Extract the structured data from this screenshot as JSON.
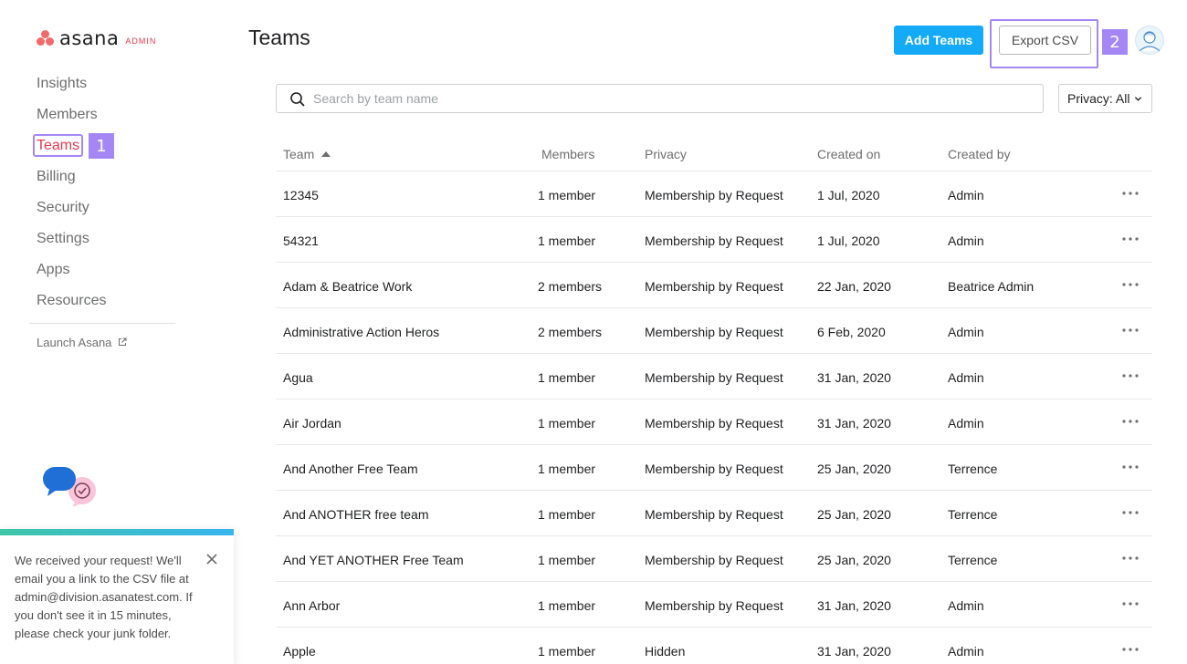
{
  "logo": {
    "word": "asana",
    "tag": "ADMIN"
  },
  "sidebar": {
    "items": [
      {
        "label": "Insights",
        "name": "sidebar-item-insights",
        "active": false
      },
      {
        "label": "Members",
        "name": "sidebar-item-members",
        "active": false
      },
      {
        "label": "Teams",
        "name": "sidebar-item-teams",
        "active": true,
        "callout": "1"
      },
      {
        "label": "Billing",
        "name": "sidebar-item-billing",
        "active": false
      },
      {
        "label": "Security",
        "name": "sidebar-item-security",
        "active": false
      },
      {
        "label": "Settings",
        "name": "sidebar-item-settings",
        "active": false
      },
      {
        "label": "Apps",
        "name": "sidebar-item-apps",
        "active": false
      },
      {
        "label": "Resources",
        "name": "sidebar-item-resources",
        "active": false
      }
    ],
    "launch_label": "Launch Asana",
    "launch_icon": "external-link-icon"
  },
  "toast": {
    "message": "We received your request! We'll email you a link to the CSV file at admin@division.asanatest.com. If you don't see it in 15 minutes, please check your junk folder."
  },
  "header": {
    "title": "Teams",
    "add_label": "Add Teams",
    "export_label": "Export CSV",
    "export_callout": "2"
  },
  "search": {
    "placeholder": "Search by team name",
    "value": ""
  },
  "filter": {
    "privacy_label": "Privacy: All"
  },
  "colors": {
    "accent": "#14aaf5",
    "active_nav": "#e8384f",
    "callout": "#a487f5",
    "brand": "#f06a6a"
  },
  "table": {
    "headers": {
      "team": "Team",
      "members": "Members",
      "privacy": "Privacy",
      "created_on": "Created on",
      "created_by": "Created by"
    },
    "rows": [
      {
        "team": "12345",
        "members": "1 member",
        "privacy": "Membership by Request",
        "created_on": "1 Jul, 2020",
        "created_by": "Admin"
      },
      {
        "team": "54321",
        "members": "1 member",
        "privacy": "Membership by Request",
        "created_on": "1 Jul, 2020",
        "created_by": "Admin"
      },
      {
        "team": "Adam & Beatrice Work",
        "members": "2 members",
        "privacy": "Membership by Request",
        "created_on": "22 Jan, 2020",
        "created_by": "Beatrice Admin"
      },
      {
        "team": "Administrative Action Heros",
        "members": "2 members",
        "privacy": "Membership by Request",
        "created_on": "6 Feb, 2020",
        "created_by": "Admin"
      },
      {
        "team": "Agua",
        "members": "1 member",
        "privacy": "Membership by Request",
        "created_on": "31 Jan, 2020",
        "created_by": "Admin"
      },
      {
        "team": "Air Jordan",
        "members": "1 member",
        "privacy": "Membership by Request",
        "created_on": "31 Jan, 2020",
        "created_by": "Admin"
      },
      {
        "team": "And Another Free Team",
        "members": "1 member",
        "privacy": "Membership by Request",
        "created_on": "25 Jan, 2020",
        "created_by": "Terrence"
      },
      {
        "team": "And ANOTHER free team",
        "members": "1 member",
        "privacy": "Membership by Request",
        "created_on": "25 Jan, 2020",
        "created_by": "Terrence"
      },
      {
        "team": "And YET ANOTHER Free Team",
        "members": "1 member",
        "privacy": "Membership by Request",
        "created_on": "25 Jan, 2020",
        "created_by": "Terrence"
      },
      {
        "team": "Ann Arbor",
        "members": "1 member",
        "privacy": "Membership by Request",
        "created_on": "31 Jan, 2020",
        "created_by": "Admin"
      },
      {
        "team": "Apple",
        "members": "1 member",
        "privacy": "Hidden",
        "created_on": "31 Jan, 2020",
        "created_by": "Admin"
      }
    ]
  }
}
